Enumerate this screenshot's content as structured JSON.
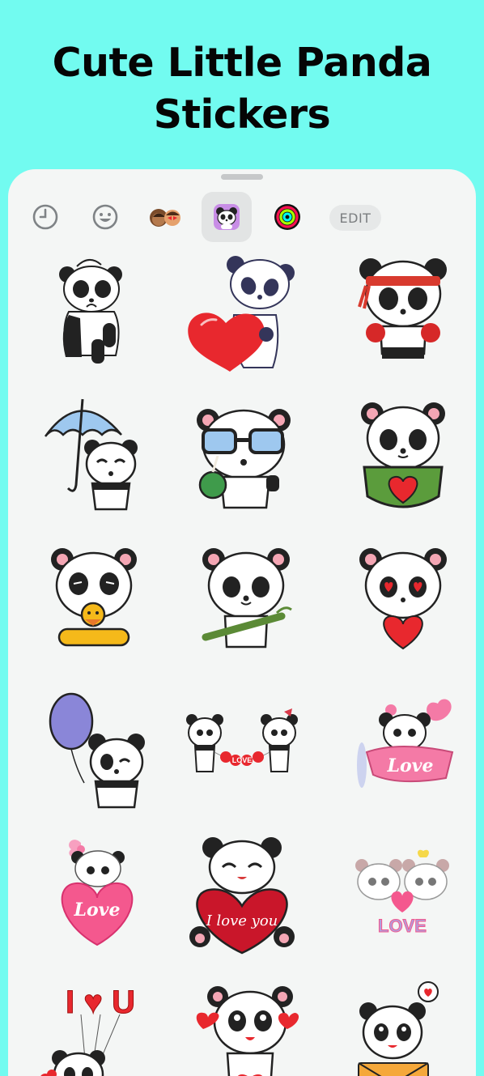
{
  "headline": {
    "line1": "Cute Little Panda",
    "line2": "Stickers"
  },
  "tabs": [
    {
      "icon": "clock-icon",
      "active": false
    },
    {
      "icon": "smiley-icon",
      "active": false
    },
    {
      "icon": "memoji-icon",
      "active": false
    },
    {
      "icon": "panda-sticker-pack-icon",
      "active": true
    },
    {
      "icon": "activity-rings-icon",
      "active": false
    }
  ],
  "edit_label": "EDIT",
  "colors": {
    "background": "#72fbf0",
    "sheet": "#f4f6f5",
    "heart": "#e8282e",
    "pink": "#f47aa6"
  },
  "stickers": [
    {
      "name": "sad-panda-sticker"
    },
    {
      "name": "panda-holding-heart-sticker"
    },
    {
      "name": "boxer-panda-sticker"
    },
    {
      "name": "panda-umbrella-sticker"
    },
    {
      "name": "panda-sunglasses-coconut-sticker"
    },
    {
      "name": "panda-pocket-heart-sticker"
    },
    {
      "name": "panda-duck-float-sticker"
    },
    {
      "name": "panda-bamboo-sticker"
    },
    {
      "name": "panda-heart-eyes-sticker"
    },
    {
      "name": "panda-balloon-sticker"
    },
    {
      "name": "pandas-love-garland-sticker",
      "text": "LOVE"
    },
    {
      "name": "panda-love-airplane-sticker",
      "text": "Love"
    },
    {
      "name": "panda-love-heart-balloon-sticker",
      "text": "Love"
    },
    {
      "name": "panda-i-love-you-sticker",
      "text": "I love you"
    },
    {
      "name": "panda-couple-love-sticker",
      "text": "LOVE"
    },
    {
      "name": "panda-i-love-u-balloons-sticker",
      "text": "I ♥ U"
    },
    {
      "name": "panda-hearts-sticker"
    },
    {
      "name": "panda-love-letter-sticker"
    }
  ]
}
